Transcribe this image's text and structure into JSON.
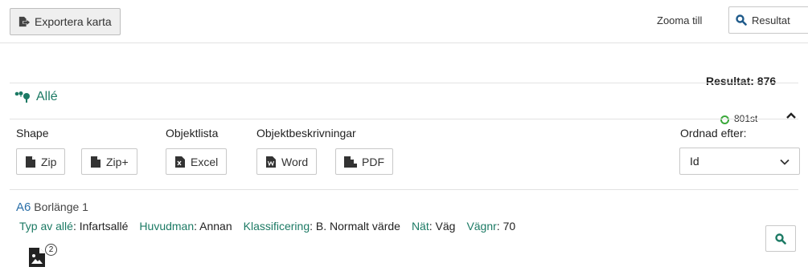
{
  "toolbar": {
    "export_label": "Exportera karta",
    "zoom_label": "Zooma till",
    "result_button_label": "Resultat"
  },
  "result_total": "Resultat: 876",
  "category": {
    "name": "Allé",
    "count": "801st",
    "status_color": "#3aa83a"
  },
  "exports": {
    "shape_heading": "Shape",
    "zip_label": "Zip",
    "zip_plus_label": "Zip+",
    "list_heading": "Objektlista",
    "excel_label": "Excel",
    "descriptions_heading": "Objektbeskrivningar",
    "word_label": "Word",
    "pdf_label": "PDF"
  },
  "sort": {
    "heading": "Ordnad efter:",
    "selected": "Id"
  },
  "item": {
    "id": "A6",
    "name": "Borlänge 1",
    "typ_key": "Typ av allé",
    "typ_value": ": Infartsallé",
    "huvudman_key": "Huvudman",
    "huvudman_value": ": Annan",
    "klass_key": "Klassificering",
    "klass_value": ": B. Normalt värde",
    "nat_key": "Nät",
    "nat_value": ": Väg",
    "vagnr_key": "Vägnr",
    "vagnr_value": ": 70",
    "image_count": "2"
  },
  "colors": {
    "accent": "#1c7a64",
    "link": "#2a6fa8"
  }
}
